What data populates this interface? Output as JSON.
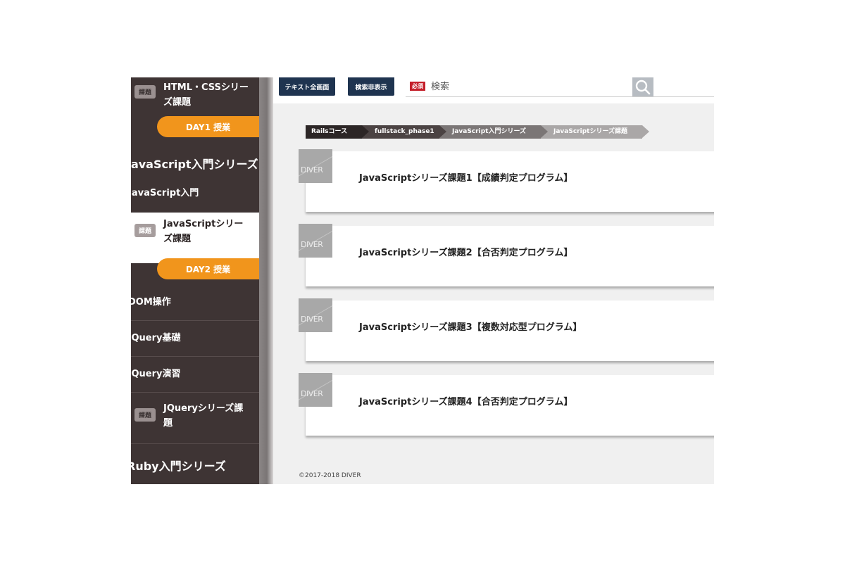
{
  "sidebar": {
    "task1": {
      "badge": "課題",
      "label": "HTML・CSSシリーズ課題"
    },
    "day1": "DAY1 授業",
    "section_js": "JavaScript入門シリーズ",
    "js_intro": "JavaScript入門",
    "task2": {
      "badge": "課題",
      "label": "JavaScriptシリーズ課題"
    },
    "day2": "DAY2 授業",
    "items": [
      "DOM操作",
      "jQuery基礎",
      "jQuery演習"
    ],
    "task3": {
      "badge": "課題",
      "label": "JQueryシリーズ課題"
    },
    "section_ruby": "Ruby入門シリーズ"
  },
  "toolbar": {
    "text_full_button": "テキスト全画面",
    "search_toggle_button": "検索非表示",
    "search_tag": "必須",
    "search_placeholder": "検索"
  },
  "breadcrumb": [
    {
      "label": "Railsコース",
      "color": "#2c2626"
    },
    {
      "label": "fullstack_phase1",
      "color": "#4b4343"
    },
    {
      "label": "JavaScript入門シリーズ",
      "color": "#7b7676"
    },
    {
      "label": "JavaScriptシリーズ課題",
      "color": "#aaa7a7"
    }
  ],
  "cards": [
    {
      "thumb": "DIVER",
      "title": "JavaScriptシリーズ課題1【成績判定プログラム】"
    },
    {
      "thumb": "DIVER",
      "title": "JavaScriptシリーズ課題2【合否判定プログラム】"
    },
    {
      "thumb": "DIVER",
      "title": "JavaScriptシリーズ課題3【複数対応型プログラム】"
    },
    {
      "thumb": "DIVER",
      "title": "JavaScriptシリーズ課題4【合否判定プログラム】"
    }
  ],
  "footer": "©2017-2018 DIVER",
  "colors": {
    "accent": "#f1951c",
    "sidebar": "#3e3434",
    "button": "#1f3450",
    "tag": "#c41f2a"
  }
}
